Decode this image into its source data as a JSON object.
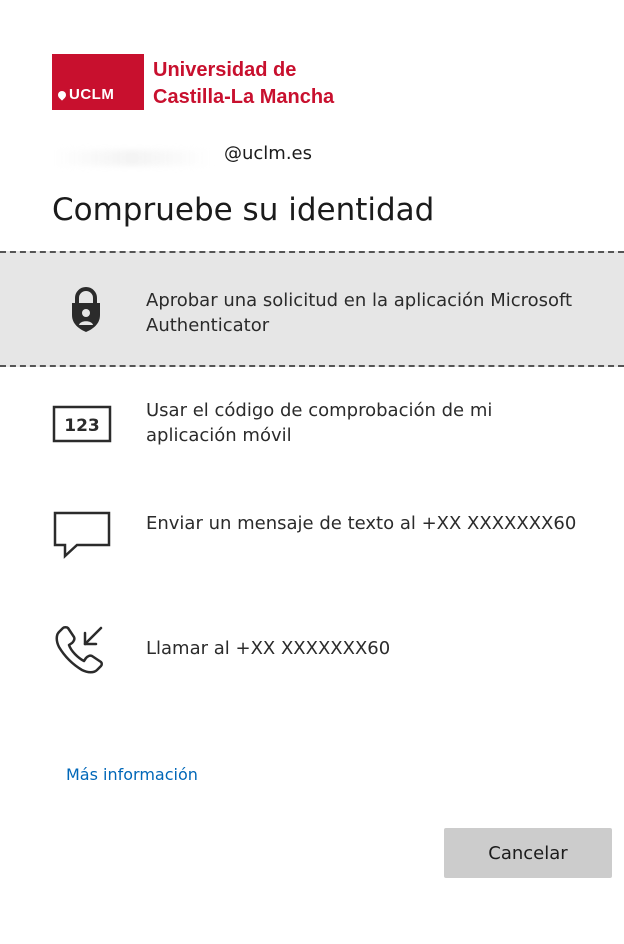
{
  "brand": {
    "logo_mark": "UCLM",
    "name_line1": "Universidad de",
    "name_line2": "Castilla-La Mancha",
    "color": "#c8102e"
  },
  "account": {
    "email_suffix": "@uclm.es"
  },
  "page_title": "Compruebe su identidad",
  "options": [
    {
      "icon": "lock-icon",
      "label": "Aprobar una solicitud en la aplicación Microsoft Authenticator",
      "selected": true
    },
    {
      "icon": "code-123-icon",
      "icon_text": "123",
      "label": "Usar el código de comprobación de mi aplicación móvil"
    },
    {
      "icon": "chat-bubble-icon",
      "label": "Enviar un mensaje de texto al +XX XXXXXXX60"
    },
    {
      "icon": "incoming-call-icon",
      "label": "Llamar al +XX XXXXXXX60"
    }
  ],
  "links": {
    "more_info": "Más información"
  },
  "buttons": {
    "cancel": "Cancelar"
  },
  "colors": {
    "link": "#0067b8",
    "selected_bg": "#e6e6e6",
    "button_bg": "#cccccc"
  }
}
